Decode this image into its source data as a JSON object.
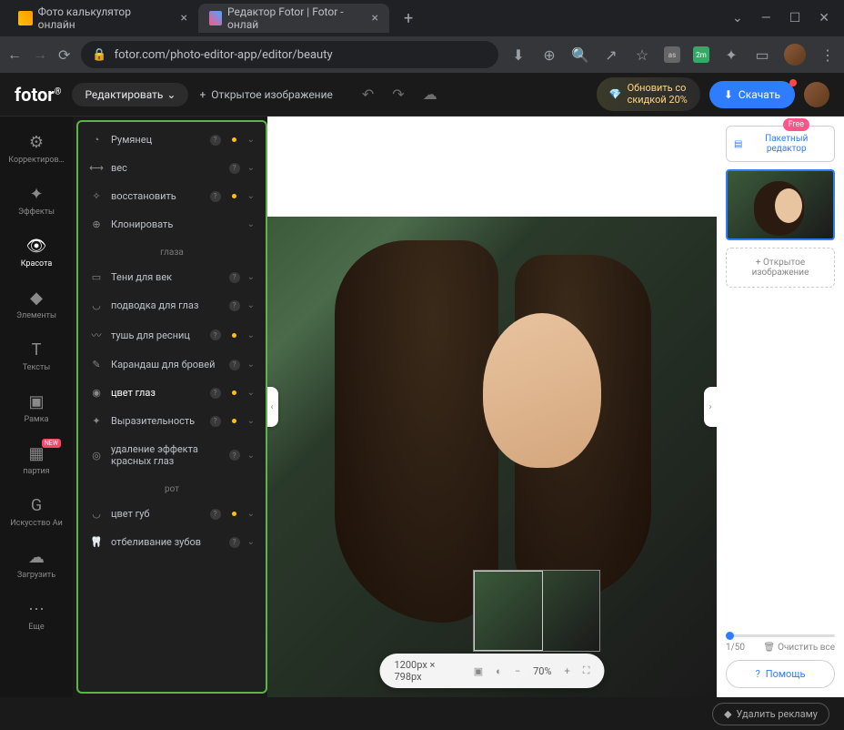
{
  "browser": {
    "tabs": [
      {
        "title": "Фото калькулятор онлайн"
      },
      {
        "title": "Редактор Fotor | Fotor - онлай"
      }
    ],
    "url": "fotor.com/photo-editor-app/editor/beauty"
  },
  "app": {
    "logo": "fotor",
    "edit_btn": "Редактировать",
    "open_image": "Открытое изображение",
    "upgrade_line1": "Обновить со",
    "upgrade_line2": "скидкой 20%",
    "download": "Скачать"
  },
  "leftnav": [
    {
      "icon": "⚙",
      "label": "Корректиров…"
    },
    {
      "icon": "✦",
      "label": "Эффекты"
    },
    {
      "icon": "👁",
      "label": "Красота"
    },
    {
      "icon": "◆",
      "label": "Элементы"
    },
    {
      "icon": "T",
      "label": "Тексты"
    },
    {
      "icon": "▣",
      "label": "Рамка"
    },
    {
      "icon": "▦",
      "label": "партия",
      "new": true
    },
    {
      "icon": "G",
      "label": "Искусство Аи"
    },
    {
      "icon": "☁",
      "label": "Загрузить"
    },
    {
      "icon": "⋯",
      "label": "Еще"
    }
  ],
  "options": [
    {
      "type": "item",
      "icon": "◔",
      "label": "Румянец",
      "help": true,
      "dot": true,
      "chev": "⌄"
    },
    {
      "type": "item",
      "icon": "⟷",
      "label": "вес",
      "help": true,
      "dot": false,
      "chev": "⌄"
    },
    {
      "type": "item",
      "icon": "✧",
      "label": "восстановить",
      "help": true,
      "dot": true,
      "chev": "⌄"
    },
    {
      "type": "item",
      "icon": "⊕",
      "label": "Клонировать",
      "help": false,
      "dot": false,
      "chev": "⌄"
    },
    {
      "type": "section",
      "label": "глаза"
    },
    {
      "type": "item",
      "icon": "▭",
      "label": "Тени для век",
      "help": true,
      "dot": false,
      "chev": "⌄"
    },
    {
      "type": "item",
      "icon": "◡",
      "label": "подводка для глаз",
      "help": true,
      "dot": false,
      "chev": "⌄"
    },
    {
      "type": "item",
      "icon": "〰",
      "label": "тушь для ресниц",
      "help": true,
      "dot": true,
      "chev": "⌄"
    },
    {
      "type": "item",
      "icon": "✎",
      "label": "Карандаш для бровей",
      "help": true,
      "dot": false,
      "chev": "⌄"
    },
    {
      "type": "item",
      "icon": "◉",
      "label": "цвет глаз",
      "help": true,
      "dot": true,
      "chev": "⌄",
      "active": true
    },
    {
      "type": "item",
      "icon": "✦",
      "label": "Выразительность",
      "help": true,
      "dot": true,
      "chev": "⌄"
    },
    {
      "type": "item",
      "icon": "◎",
      "label": "удаление эффекта красных глаз",
      "help": true,
      "dot": false,
      "chev": "⌄"
    },
    {
      "type": "section",
      "label": "рот"
    },
    {
      "type": "item",
      "icon": "◡",
      "label": "цвет губ",
      "help": true,
      "dot": true,
      "chev": "⌄"
    },
    {
      "type": "item",
      "icon": "🦷",
      "label": "отбеливание зубов",
      "help": true,
      "dot": false,
      "chev": "⌄"
    }
  ],
  "zoom": {
    "dims": "1200px × 798px",
    "pct": "70%"
  },
  "right": {
    "free": "Free",
    "batch": "Пакетный редактор",
    "add": "Открытое изображение",
    "page": "1/50",
    "clear": "Очистить все",
    "help": "Помощь"
  },
  "footer": {
    "remove_ads": "Удалить рекламу"
  },
  "new_badge": "NEW"
}
